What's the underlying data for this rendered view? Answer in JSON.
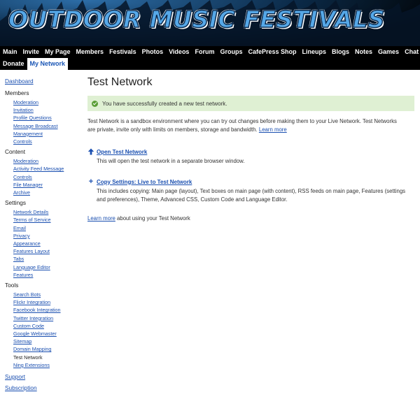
{
  "site": {
    "title": "OUTDOOR MUSIC FESTIVALS"
  },
  "nav": {
    "row1": [
      "Main",
      "Invite",
      "My Page",
      "Members",
      "Festivals",
      "Photos",
      "Videos",
      "Forum",
      "Groups",
      "CafePress Shop",
      "Lineups",
      "Blogs",
      "Notes",
      "Games",
      "Chat"
    ],
    "row2": [
      "Donate",
      "My Network"
    ],
    "active": "My Network"
  },
  "sidebar": {
    "dashboard": "Dashboard",
    "members": {
      "heading": "Members",
      "items": [
        "Moderation",
        "Invitation",
        "Profile Questions",
        "Message Broadcast",
        "Management",
        "Controls"
      ]
    },
    "content": {
      "heading": "Content",
      "items": [
        "Moderation",
        "Activity Feed Message",
        "Controls",
        "File Manager",
        "Archive"
      ]
    },
    "settings": {
      "heading": "Settings",
      "items": [
        "Network Details",
        "Terms of Service",
        "Email",
        "Privacy",
        "Appearance",
        "Features Layout",
        "Tabs",
        "Language Editor",
        "Features"
      ]
    },
    "tools": {
      "heading": "Tools",
      "items": [
        "Search Bots",
        "Flickr Integration",
        "Facebook Integration",
        "Twitter Integration",
        "Custom Code",
        "Google Webmaster",
        "Sitemap",
        "Domain Mapping"
      ],
      "current": "Test Network",
      "after": [
        "Ning Extensions"
      ]
    },
    "support": "Support",
    "subscription": "Subscription"
  },
  "main": {
    "title": "Test Network",
    "success_message": "You have successfully created a new test network.",
    "intro_text": "Test Network is a sandbox environment where you can try out changes before making them to your Live Network. Test Networks are private, invite only with limits on members, storage and bandwidth.",
    "intro_link": "Learn more",
    "open_link": "Open Test Network",
    "open_desc": "This will open the test network in a separate browser window.",
    "copy_link": "Copy Settings: Live to Test Network",
    "copy_desc": "This includes copying: Main page (layout), Text boxes on main page (with content), RSS feeds on main page, Features (settings and preferences), Theme, Advanced CSS, Custom Code and Language Editor.",
    "learn_link": "Learn more",
    "learn_text": " about using your Test Network"
  },
  "colors": {
    "link": "#1a4fb0",
    "success_bg": "#dff0d3",
    "check": "#5a9e36",
    "nav_bg": "#000000",
    "title": "#56a8e8"
  }
}
